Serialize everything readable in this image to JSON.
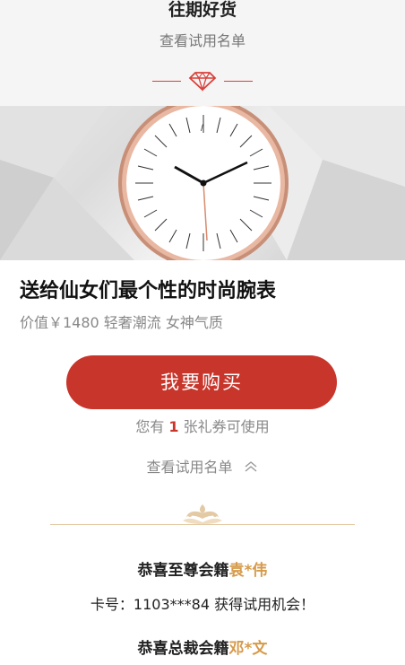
{
  "header": {
    "title": "往期好货",
    "subtitle": "查看试用名单"
  },
  "product": {
    "name": "送给仙女们最个性的时尚腕表",
    "price_text": "价值￥1480 轻奢潮流 女神气质",
    "buy_label": "我要购买"
  },
  "coupon": {
    "prefix": "您有",
    "count": "1",
    "suffix": "张礼券可使用"
  },
  "trial_list": {
    "toggle_label": "查看试用名单"
  },
  "winners": [
    {
      "title": "恭喜至尊会籍",
      "name": "袁*伟",
      "card_label": "卡号：",
      "card_no": "1103***84",
      "card_suffix": " 获得试用机会！"
    },
    {
      "title": "恭喜总裁会籍",
      "name": "邓*文"
    }
  ],
  "colors": {
    "accent_red": "#c8352b",
    "name_gold": "#d69a4b",
    "ornament_gold": "#e3c9a4"
  },
  "icons": [
    "diamond-icon",
    "chevron-up-icon",
    "ornament-icon"
  ]
}
